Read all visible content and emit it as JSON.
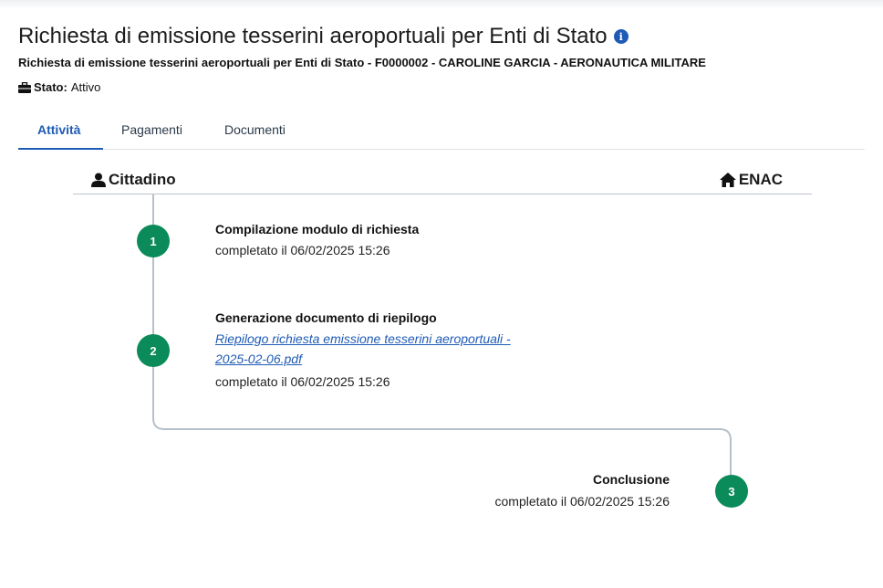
{
  "header": {
    "title": "Richiesta di emissione tesserini aeroportuali per Enti di Stato",
    "info_icon": "info-icon",
    "subtitle": "Richiesta di emissione tesserini aeroportuali per Enti di Stato - F0000002 - CAROLINE GARCIA - AERONAUTICA MILITARE",
    "status_label": "Stato:",
    "status_value": "Attivo"
  },
  "tabs": [
    {
      "label": "Attività",
      "active": true
    },
    {
      "label": "Pagamenti",
      "active": false
    },
    {
      "label": "Documenti",
      "active": false
    }
  ],
  "lanes": {
    "left": {
      "label": "Cittadino",
      "icon": "user-icon"
    },
    "right": {
      "label": "ENAC",
      "icon": "home-icon"
    }
  },
  "steps": [
    {
      "number": "1",
      "title": "Compilazione modulo di richiesta",
      "status": "completato il 06/02/2025 15:26"
    },
    {
      "number": "2",
      "title": "Generazione documento di riepilogo",
      "link_line1": "Riepilogo richiesta emissione tesserini aeroportuali -",
      "link_line2": "2025-02-06.pdf",
      "status": "completato il 06/02/2025 15:26"
    },
    {
      "number": "3",
      "title": "Conclusione",
      "status": "completato il 06/02/2025 15:26"
    }
  ],
  "colors": {
    "accent": "#1f5bb5",
    "step": "#0b8a5a"
  }
}
